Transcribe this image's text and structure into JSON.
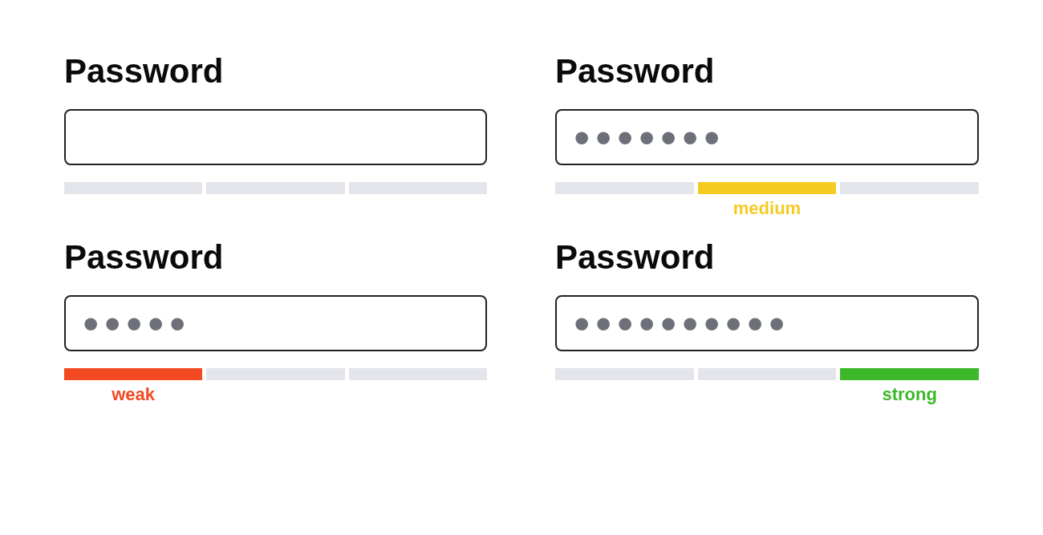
{
  "password_fields": [
    {
      "label": "Password",
      "strength": {
        "segments": [
          {
            "on": false
          },
          {
            "on": false
          },
          {
            "on": false
          }
        ]
      }
    },
    {
      "label": "Password",
      "value": "•••••••",
      "strength": {
        "label": "medium",
        "color": "#f4cb22",
        "segments": [
          {
            "on": false
          },
          {
            "on": true
          },
          {
            "on": false
          }
        ]
      }
    },
    {
      "label": "Password",
      "value": "•••••",
      "strength": {
        "label": "weak",
        "color": "#f24a22",
        "segments": [
          {
            "on": true
          },
          {
            "on": false
          },
          {
            "on": false
          }
        ]
      }
    },
    {
      "label": "Password",
      "value": "••••••••••",
      "strength": {
        "label": "strong",
        "color": "#3cb82a",
        "segments": [
          {
            "on": false
          },
          {
            "on": false
          },
          {
            "on": true
          }
        ]
      }
    }
  ]
}
